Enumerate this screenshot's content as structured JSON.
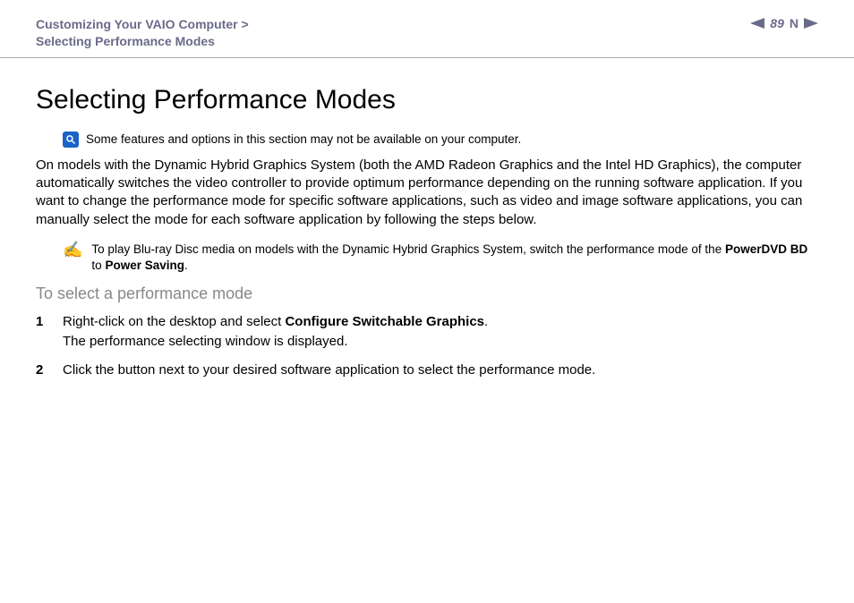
{
  "header": {
    "breadcrumb_line1": "Customizing Your VAIO Computer >",
    "breadcrumb_line2": "Selecting Performance Modes",
    "page_number": "89",
    "n_label": "N"
  },
  "title": "Selecting Performance Modes",
  "note": {
    "text": "Some features and options in this section may not be available on your computer."
  },
  "intro": "On models with the Dynamic Hybrid Graphics System (both the AMD Radeon Graphics and the Intel HD Graphics), the computer automatically switches the video controller to provide optimum performance depending on the running software application. If you want to change the performance mode for specific software applications, such as video and image software applications, you can manually select the mode for each software application by following the steps below.",
  "pencil": {
    "prefix": "To play Blu-ray Disc media on models with the Dynamic Hybrid Graphics System, switch the performance mode of the ",
    "bold1": "PowerDVD BD",
    "mid": " to ",
    "bold2": "Power Saving",
    "suffix": "."
  },
  "subtitle": "To select a performance mode",
  "steps": [
    {
      "num": "1",
      "line1_prefix": "Right-click on the desktop and select ",
      "line1_bold": "Configure Switchable Graphics",
      "line1_suffix": ".",
      "line2": "The performance selecting window is displayed."
    },
    {
      "num": "2",
      "line1_prefix": "Click the button next to your desired software application to select the performance mode.",
      "line1_bold": "",
      "line1_suffix": "",
      "line2": ""
    }
  ]
}
